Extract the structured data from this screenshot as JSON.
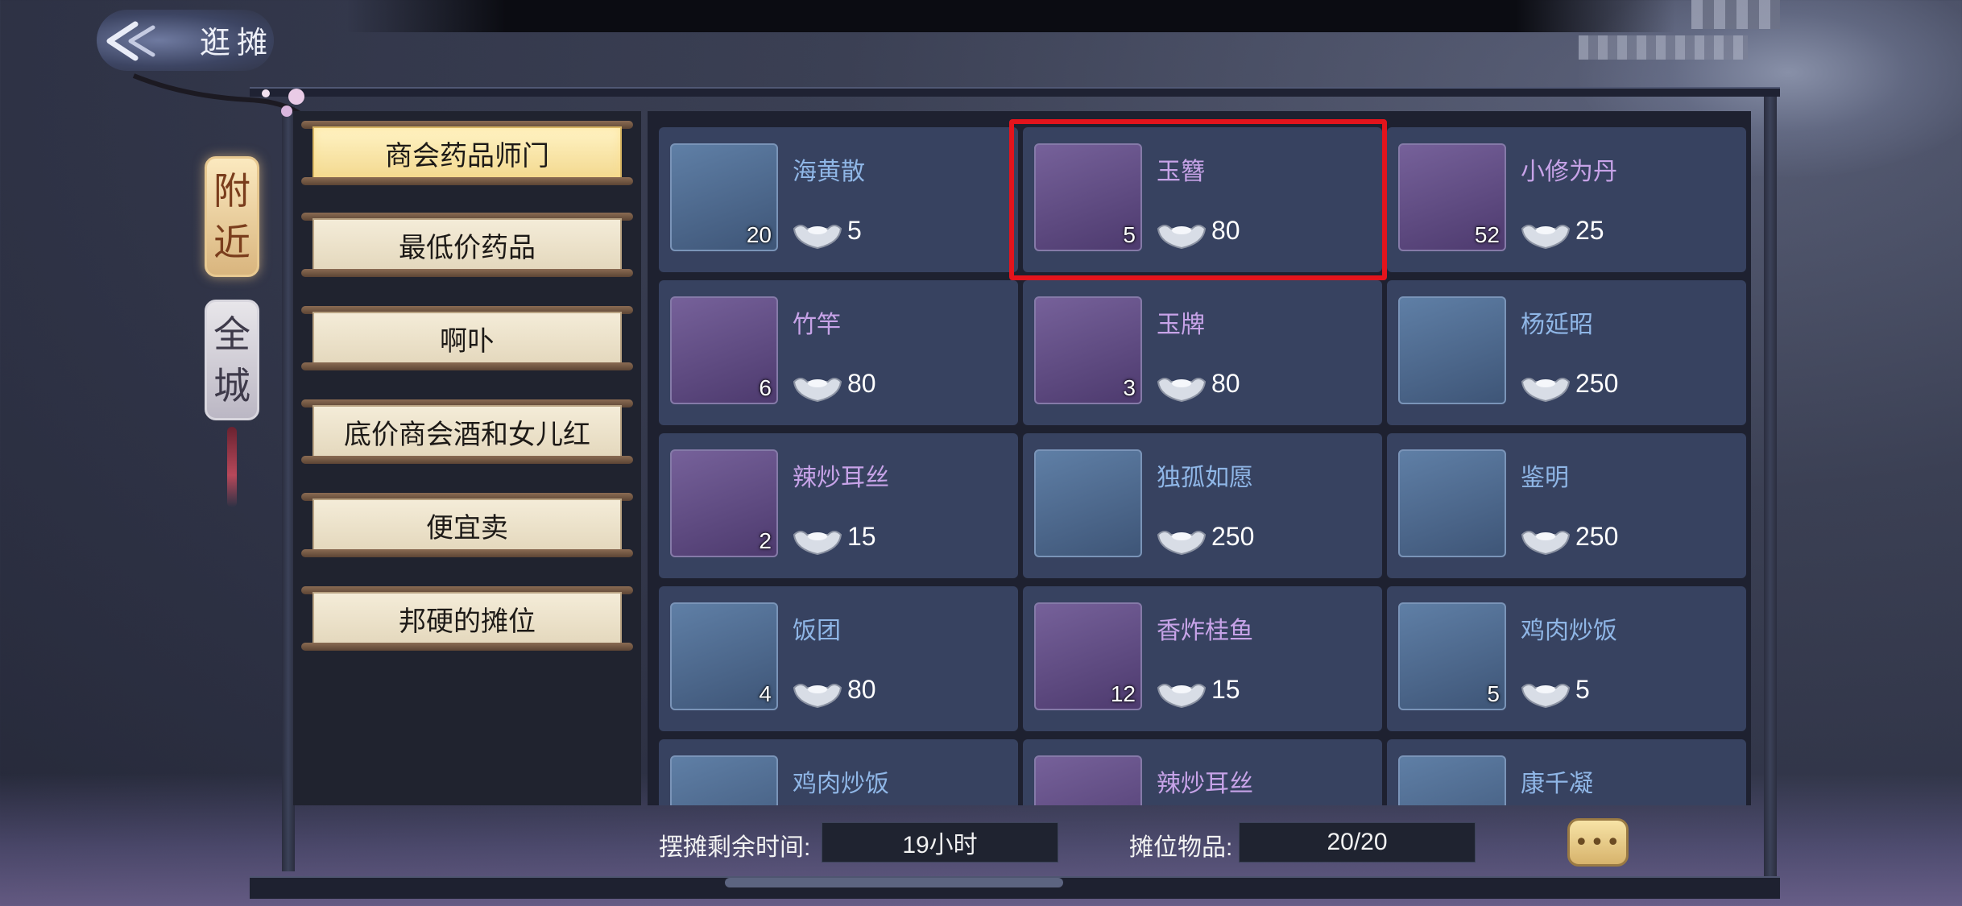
{
  "header": {
    "title": "逛摊"
  },
  "side_tabs": [
    {
      "label_line1": "附",
      "label_line2": "近",
      "active": true
    },
    {
      "label_line1": "全",
      "label_line2": "城",
      "active": false
    }
  ],
  "stalls": [
    {
      "label": "商会药品师门",
      "active": true
    },
    {
      "label": "最低价药品",
      "active": false
    },
    {
      "label": "啊卟",
      "active": false
    },
    {
      "label": "底价商会酒和女儿红",
      "active": false
    },
    {
      "label": "便宜卖",
      "active": false
    },
    {
      "label": "邦硬的摊位",
      "active": false
    }
  ],
  "items": [
    {
      "name": "海黄散",
      "qty": "20",
      "price": "5",
      "name_color": "blue",
      "icon": "blue-powder-bottle-icon"
    },
    {
      "name": "玉簪",
      "qty": "5",
      "price": "80",
      "name_color": "purple",
      "icon": "jade-hairpin-icon"
    },
    {
      "name": "小修为丹",
      "qty": "52",
      "price": "25",
      "name_color": "purple",
      "icon": "gourd-icon"
    },
    {
      "name": "竹竿",
      "qty": "6",
      "price": "80",
      "name_color": "purple",
      "icon": "bamboo-pole-icon"
    },
    {
      "name": "玉牌",
      "qty": "3",
      "price": "80",
      "name_color": "purple",
      "icon": "jade-pendant-icon"
    },
    {
      "name": "杨延昭",
      "qty": "",
      "price": "250",
      "name_color": "blue",
      "icon": "character-portrait-icon"
    },
    {
      "name": "辣炒耳丝",
      "qty": "2",
      "price": "15",
      "name_color": "purple",
      "icon": "fried-dish-icon"
    },
    {
      "name": "独孤如愿",
      "qty": "",
      "price": "250",
      "name_color": "blue",
      "icon": "elder-portrait-icon"
    },
    {
      "name": "鉴明",
      "qty": "",
      "price": "250",
      "name_color": "blue",
      "icon": "monk-portrait-icon"
    },
    {
      "name": "饭团",
      "qty": "4",
      "price": "80",
      "name_color": "blue",
      "icon": "rice-ball-icon"
    },
    {
      "name": "香炸桂鱼",
      "qty": "12",
      "price": "15",
      "name_color": "purple",
      "icon": "fried-fish-icon"
    },
    {
      "name": "鸡肉炒饭",
      "qty": "5",
      "price": "5",
      "name_color": "blue",
      "icon": "fried-rice-icon"
    },
    {
      "name": "鸡肉炒饭",
      "qty": "",
      "price": "",
      "name_color": "blue",
      "icon": "fried-rice-icon"
    },
    {
      "name": "辣炒耳丝",
      "qty": "",
      "price": "",
      "name_color": "purple",
      "icon": "fried-dish-icon"
    },
    {
      "name": "康千凝",
      "qty": "",
      "price": "",
      "name_color": "blue",
      "icon": "character-portrait-icon"
    }
  ],
  "status": {
    "time_label": "摆摊剩余时间:",
    "time_value": "19小时",
    "goods_label": "摊位物品:",
    "goods_value": "20/20"
  },
  "chat_icon": "chat-bubble-icon",
  "colors": {
    "highlight": "#e3141c",
    "active_tab": "#f3d990",
    "name_purple": "#c7a3e8",
    "name_blue": "#8fb6e6"
  }
}
